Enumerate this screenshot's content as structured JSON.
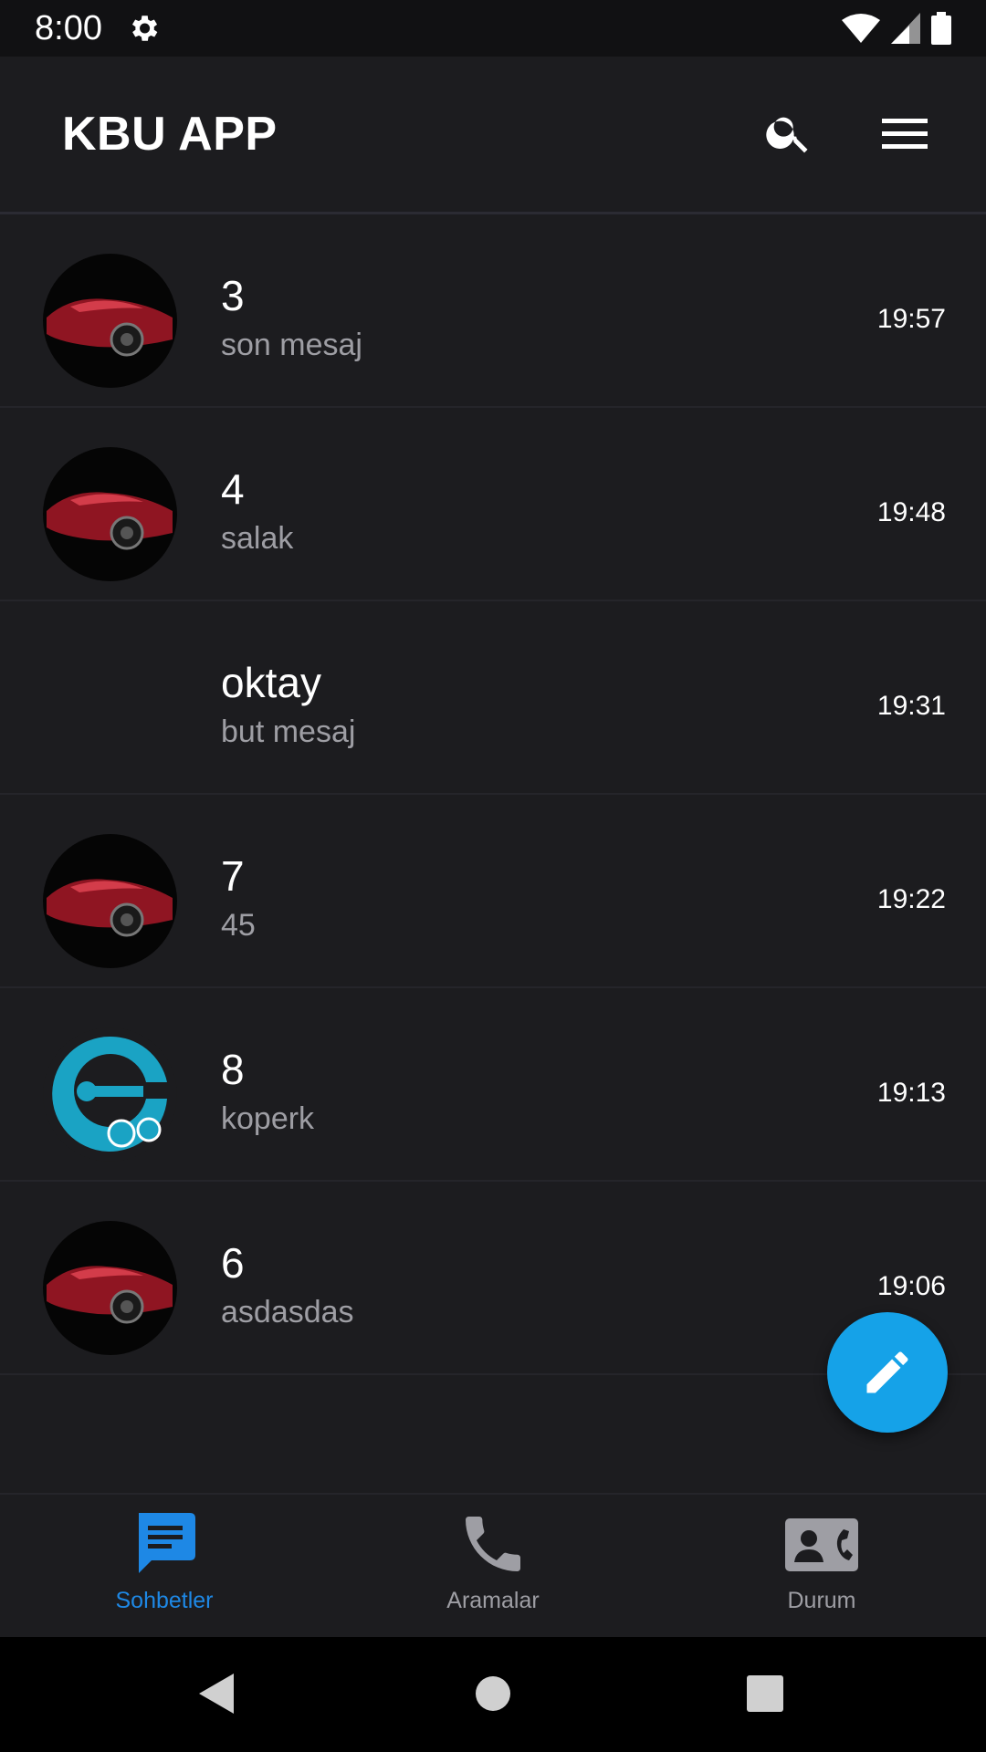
{
  "status_bar": {
    "time": "8:00",
    "icons": [
      "gear-icon",
      "wifi-icon",
      "cell-signal-icon",
      "battery-icon"
    ]
  },
  "app_bar": {
    "title": "KBU APP",
    "icons": [
      "search-icon",
      "menu-icon"
    ]
  },
  "chats": [
    {
      "name": "3",
      "last_message": "son mesaj",
      "time": "19:57",
      "avatar": "car"
    },
    {
      "name": "4",
      "last_message": "salak",
      "time": "19:48",
      "avatar": "car"
    },
    {
      "name": "oktay",
      "last_message": "but mesaj",
      "time": "19:31",
      "avatar": "none"
    },
    {
      "name": "7",
      "last_message": "45",
      "time": "19:22",
      "avatar": "car"
    },
    {
      "name": "8",
      "last_message": "koperk",
      "time": "19:13",
      "avatar": "logo"
    },
    {
      "name": "6",
      "last_message": "asdasdas",
      "time": "19:06",
      "avatar": "car"
    }
  ],
  "fab": {
    "icon": "pencil-icon"
  },
  "bottom_nav": {
    "items": [
      {
        "label": "Sohbetler",
        "icon": "chat-icon",
        "active": true
      },
      {
        "label": "Aramalar",
        "icon": "phone-icon",
        "active": false
      },
      {
        "label": "Durum",
        "icon": "contact-card-icon",
        "active": false
      }
    ]
  },
  "colors": {
    "background": "#1c1c1f",
    "accent": "#1e88e5",
    "fab": "#15a2e8",
    "secondary_text": "#9e9ea4"
  }
}
